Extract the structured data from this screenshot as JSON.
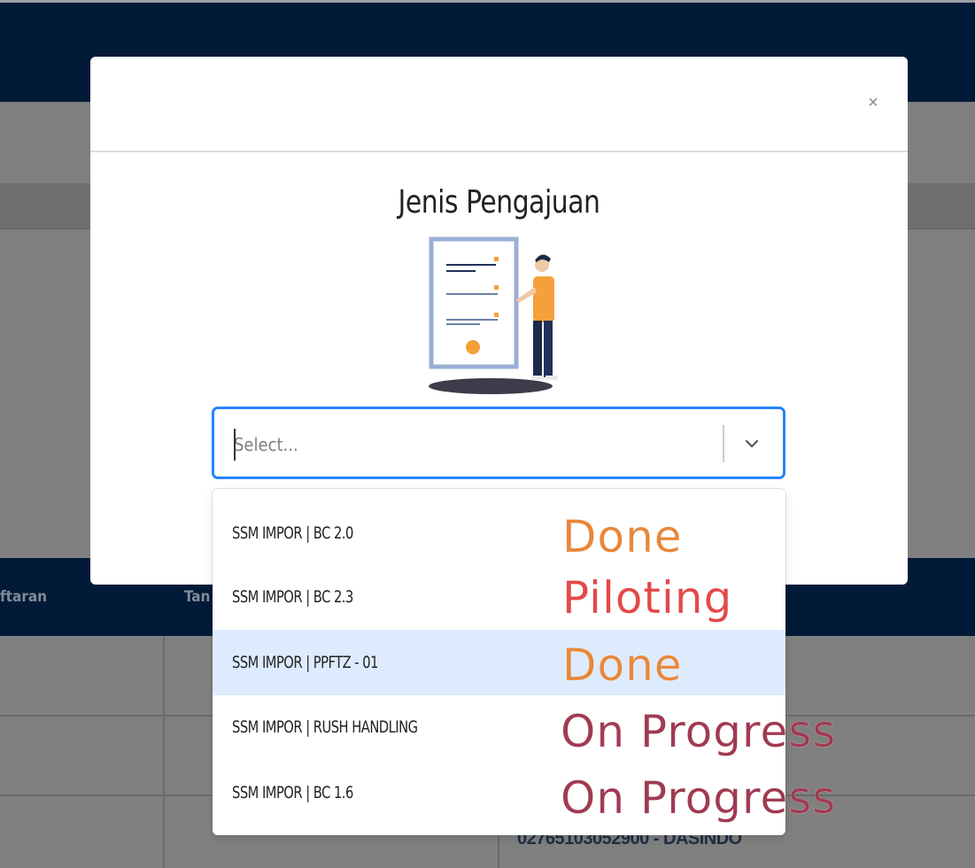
{
  "background": {
    "table_headers": [
      "ftaran",
      "Tan"
    ],
    "row_text": "02765103052900 - DASINDO"
  },
  "modal": {
    "close_label": "×",
    "title": "Jenis Pengajuan",
    "select": {
      "placeholder": "Select..."
    },
    "options": [
      {
        "label": "SSM IMPOR | BC 2.0",
        "status": "Done",
        "status_color": "#e8873a"
      },
      {
        "label": "SSM IMPOR | BC 2.3",
        "status": "Piloting",
        "status_color": "#e54848"
      },
      {
        "label": "SSM IMPOR | PPFTZ - 01",
        "status": "Done",
        "status_color": "#e8873a",
        "active": true
      },
      {
        "label": "SSM IMPOR | RUSH HANDLING",
        "status": "On Progress",
        "status_color": "#a03a52"
      },
      {
        "label": "SSM IMPOR | BC 1.6",
        "status": "On Progress",
        "status_color": "#a03a52"
      }
    ]
  },
  "colors": {
    "navy": "#001a37",
    "focus_blue": "#2684ff",
    "option_active_bg": "#deebff",
    "illustration_orange": "#f5a03a",
    "illustration_blue_frame": "#9aaed6"
  },
  "icons": [
    "close-icon",
    "chevron-down-icon",
    "document-person-illustration"
  ]
}
